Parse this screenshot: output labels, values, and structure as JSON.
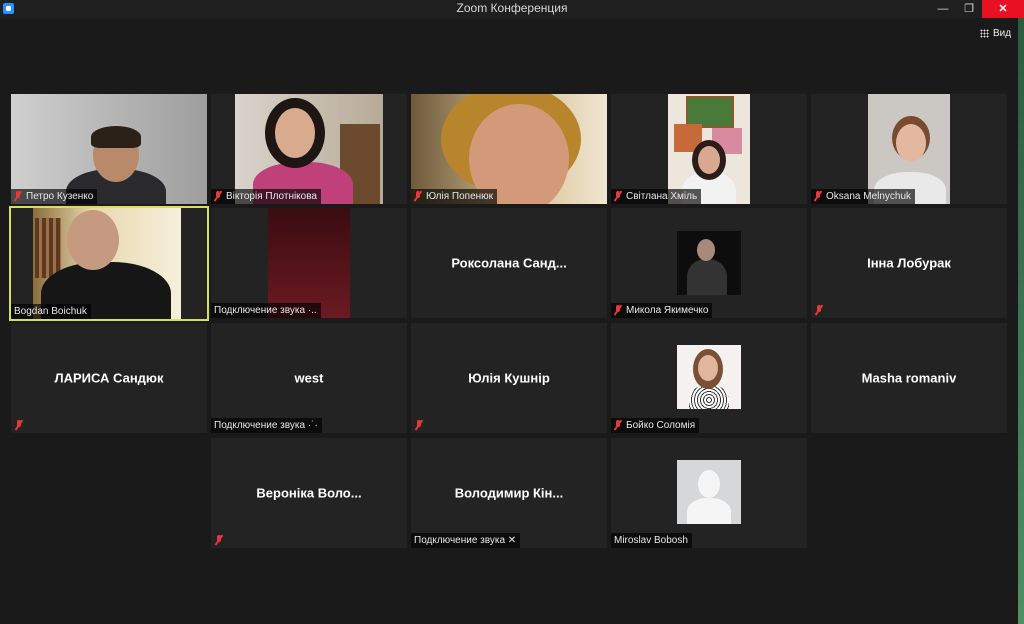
{
  "window": {
    "title": "Zoom Конференция",
    "min": "—",
    "max": "❐",
    "close": "✕"
  },
  "toolbar": {
    "view_label": "Вид"
  },
  "participants": [
    {
      "name": "Петро Кузенко",
      "muted": true
    },
    {
      "name": "Вікторія Плотнікова",
      "muted": true
    },
    {
      "name": "Юлія Попенюк",
      "muted": true
    },
    {
      "name": "Світлана Хміль",
      "muted": true
    },
    {
      "name": "Oksana Melnychuk",
      "muted": true
    },
    {
      "name": "Bogdan Boichuk",
      "muted": false,
      "active_speaker": true
    },
    {
      "name": "Подключение звука ·..",
      "muted": false
    },
    {
      "name": "Роксолана  Санд...",
      "muted": false
    },
    {
      "name": "Микола Якимечко",
      "muted": true
    },
    {
      "name": "Інна Лобурак",
      "muted": true
    },
    {
      "name": "ЛАРИСА Сандюк",
      "muted": true
    },
    {
      "name": "west",
      "status": "Подключение звука ·˙·",
      "muted": false
    },
    {
      "name": "Юлія Кушнір",
      "muted": true
    },
    {
      "name": "Бойко Соломія",
      "muted": true
    },
    {
      "name": "Masha romaniv",
      "muted": false
    },
    {
      "name": "Вероніка  Воло...",
      "muted": true
    },
    {
      "name": "Володимир  Кін...",
      "status": "Подключение звука ✕",
      "muted": false
    },
    {
      "name": "Miroslav Bobosh",
      "muted": false
    }
  ]
}
